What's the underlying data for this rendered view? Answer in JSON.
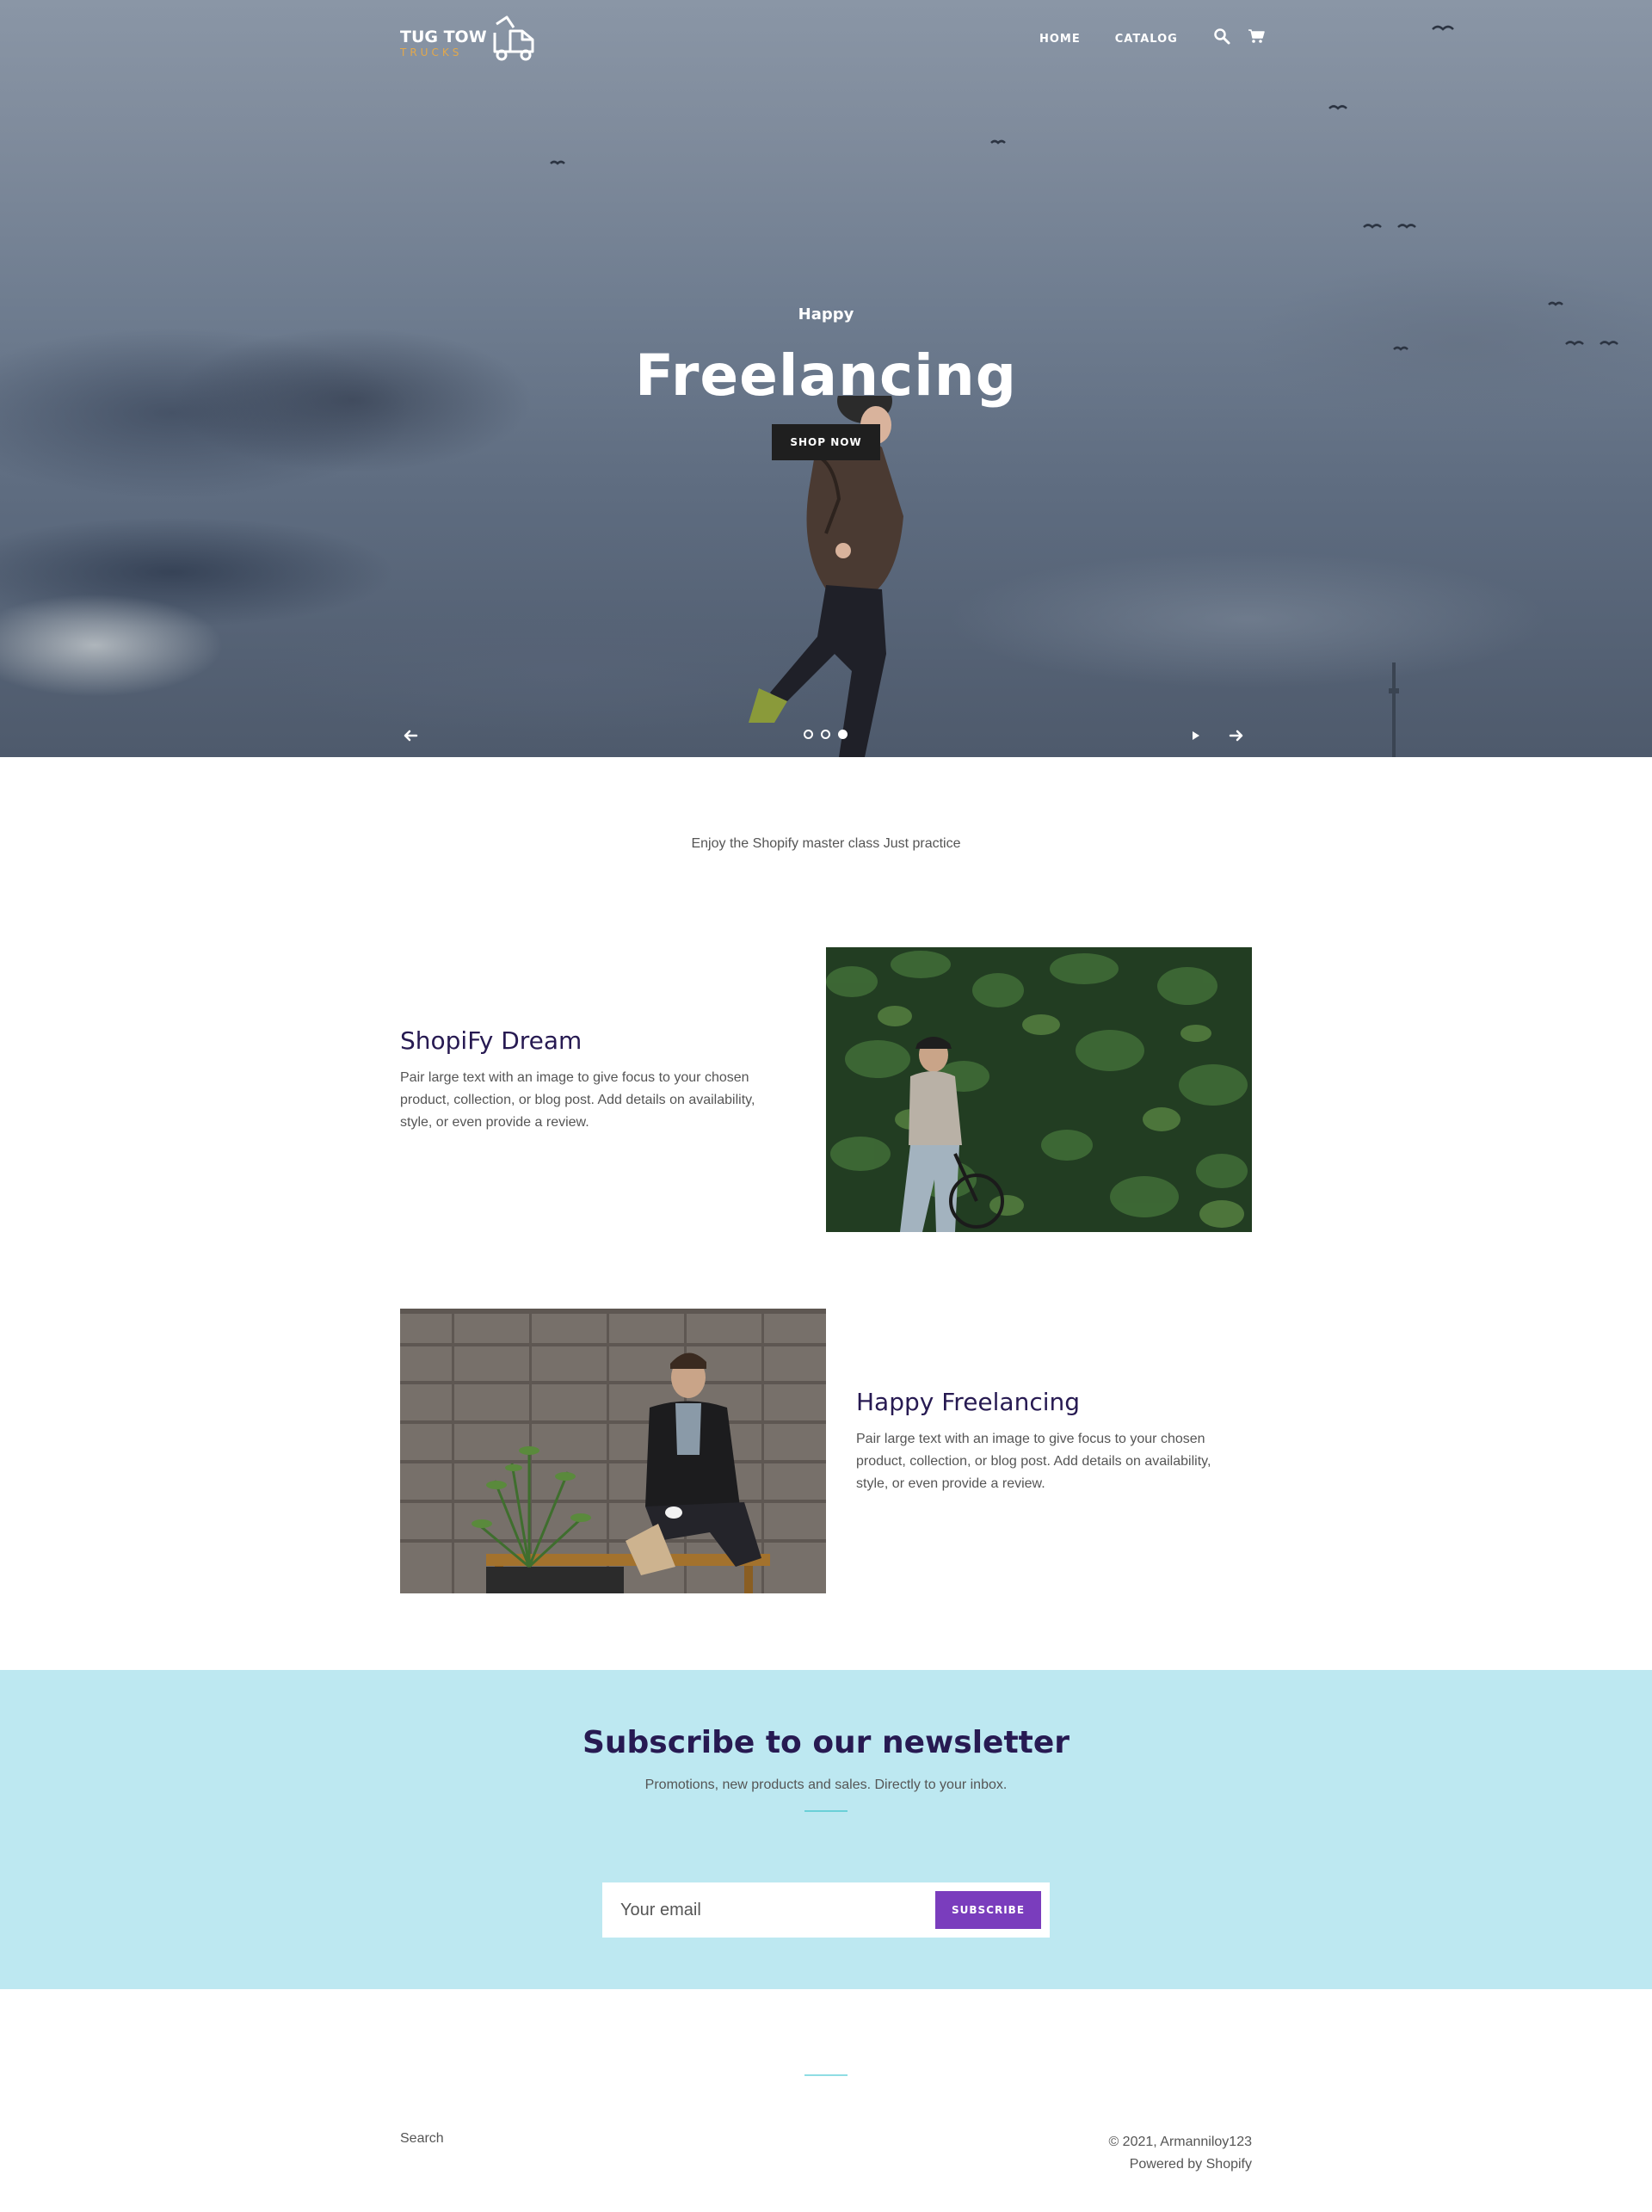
{
  "header": {
    "logo": {
      "line1": "TUG TOW",
      "line2": "TRUCKS",
      "icon": "tow-truck-icon"
    },
    "nav": [
      {
        "label": "HOME"
      },
      {
        "label": "CATALOG"
      }
    ],
    "icons": [
      "search-icon",
      "cart-icon"
    ]
  },
  "hero": {
    "subheading": "Happy",
    "heading": "Freelancing",
    "button_label": "SHOP NOW",
    "slides_total": 3,
    "active_slide": 3,
    "controls": [
      "arrow-left-icon",
      "play-icon",
      "arrow-right-icon"
    ]
  },
  "intro": {
    "text": "Enjoy the Shopify master class Just practice"
  },
  "features": [
    {
      "title": "ShopiFy Dream",
      "body": "Pair large text with an image to give focus to your chosen product, collection, or blog post. Add details on availability, style, or even provide a review."
    },
    {
      "title": "Happy Freelancing",
      "body": "Pair large text with an image to give focus to your chosen product, collection, or blog post. Add details on availability, style, or even provide a review."
    }
  ],
  "newsletter": {
    "title": "Subscribe to our newsletter",
    "subtitle": "Promotions, new products and sales. Directly to your inbox.",
    "email_placeholder": "Your email",
    "button_label": "SUBSCRIBE"
  },
  "footer": {
    "link": "Search",
    "copyright": "© 2021, Armanniloy123",
    "powered": "Powered by Shopify"
  },
  "colors": {
    "heading": "#271a52",
    "newsletter_bg": "#bde8f1",
    "subscribe_button": "#7a3dbd",
    "logo_accent": "#e3a84a"
  }
}
